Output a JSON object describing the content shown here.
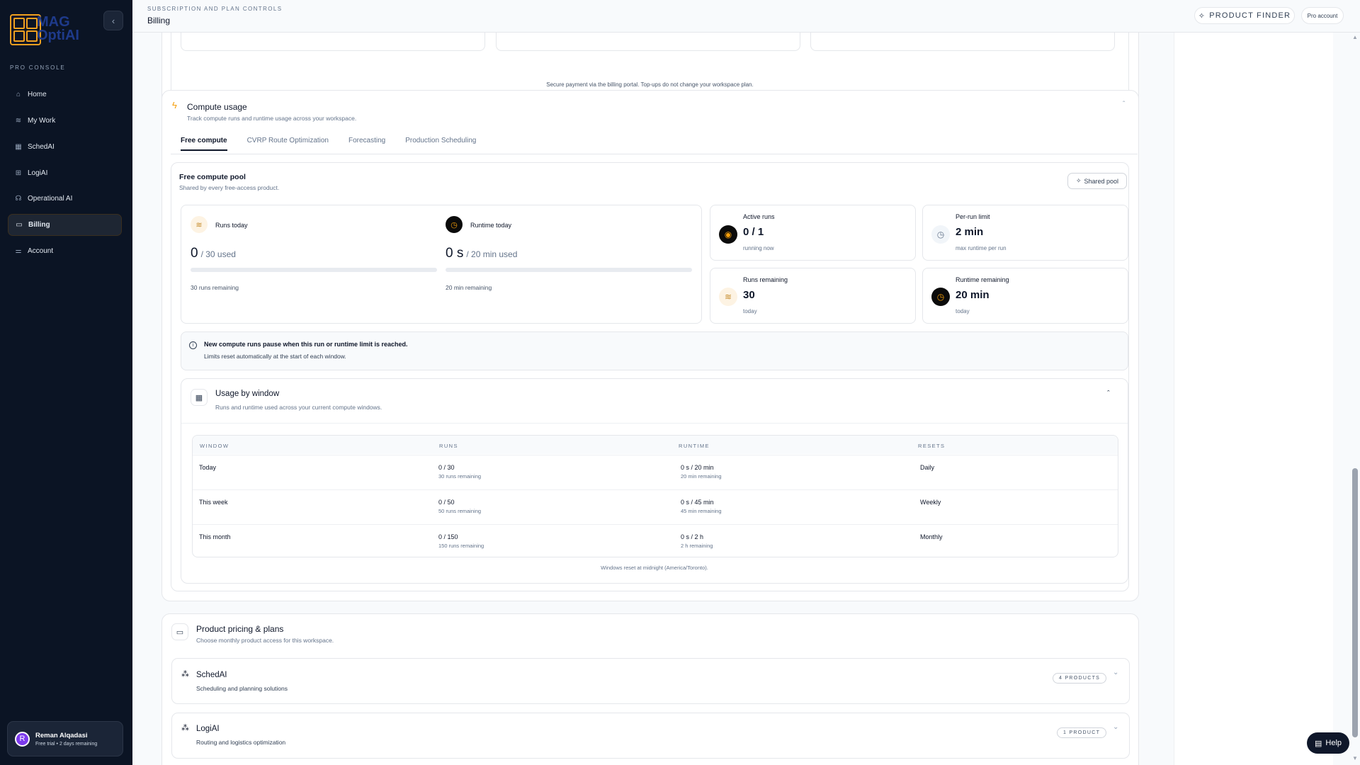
{
  "sidebar": {
    "logo_text_line1": "MAG",
    "logo_text_line2": "OptiAI",
    "section_label": "PRO CONSOLE",
    "items": [
      {
        "label": "Home",
        "icon": "home-icon"
      },
      {
        "label": "My Work",
        "icon": "layers-icon"
      },
      {
        "label": "SchedAI",
        "icon": "calendar-icon"
      },
      {
        "label": "LogiAI",
        "icon": "grid-icon"
      },
      {
        "label": "Operational AI",
        "icon": "bot-icon"
      },
      {
        "label": "Billing",
        "icon": "card-icon",
        "active": true
      },
      {
        "label": "Account",
        "icon": "sliders-icon"
      }
    ],
    "user": {
      "initial": "R",
      "name": "Reman Alqadasi",
      "status": "Free trial • 2 days remaining"
    }
  },
  "header": {
    "eyebrow": "SUBSCRIPTION AND PLAN CONTROLS",
    "title": "Billing",
    "product_finder": "PRODUCT FINDER",
    "account_badge": "Pro account"
  },
  "topup": {
    "note": "Secure payment via the billing portal. Top-ups do not change your workspace plan."
  },
  "compute": {
    "title": "Compute usage",
    "subtitle": "Track compute runs and runtime usage across your workspace.",
    "tabs": [
      "Free compute",
      "CVRP Route Optimization",
      "Forecasting",
      "Production Scheduling"
    ],
    "active_tab": 0,
    "pool": {
      "title": "Free compute pool",
      "subtitle": "Shared by every free-access product.",
      "shared_label": "Shared pool",
      "runs_today": {
        "label": "Runs today",
        "value": "0",
        "of": "/ 30 used",
        "remaining": "30 runs remaining",
        "fraction": 0
      },
      "runtime_today": {
        "label": "Runtime today",
        "value": "0 s",
        "of": "/ 20 min used",
        "remaining": "20 min remaining",
        "fraction": 0
      },
      "active_runs": {
        "label": "Active runs",
        "value": "0 / 1",
        "sub": "running now"
      },
      "per_run_limit": {
        "label": "Per-run limit",
        "value": "2 min",
        "sub": "max runtime per run"
      },
      "runs_remaining": {
        "label": "Runs remaining",
        "value": "30",
        "sub": "today"
      },
      "runtime_remaining": {
        "label": "Runtime remaining",
        "value": "20 min",
        "sub": "today"
      }
    },
    "notice": {
      "line1": "New compute runs pause when this run or runtime limit is reached.",
      "line2": "Limits reset automatically at the start of each window."
    },
    "usage": {
      "title": "Usage by window",
      "subtitle": "Runs and runtime used across your current compute windows.",
      "columns": [
        "WINDOW",
        "RUNS",
        "RUNTIME",
        "RESETS"
      ],
      "rows": [
        {
          "window": "Today",
          "runs": "0 / 30",
          "runs_sub": "30 runs remaining",
          "runtime": "0 s / 20 min",
          "runtime_sub": "20 min remaining",
          "resets": "Daily"
        },
        {
          "window": "This week",
          "runs": "0 / 50",
          "runs_sub": "50 runs remaining",
          "runtime": "0 s / 45 min",
          "runtime_sub": "45 min remaining",
          "resets": "Weekly"
        },
        {
          "window": "This month",
          "runs": "0 / 150",
          "runs_sub": "150 runs remaining",
          "runtime": "0 s / 2 h",
          "runtime_sub": "2 h remaining",
          "resets": "Monthly"
        }
      ],
      "footnote": "Windows reset at midnight (America/Toronto)."
    }
  },
  "pricing": {
    "title": "Product pricing & plans",
    "subtitle": "Choose monthly product access for this workspace.",
    "groups": [
      {
        "name": "SchedAI",
        "desc": "Scheduling and planning solutions",
        "badge": "4 PRODUCTS"
      },
      {
        "name": "LogiAI",
        "desc": "Routing and logistics optimization",
        "badge": "1 PRODUCT"
      }
    ]
  },
  "help": {
    "label": "Help"
  }
}
